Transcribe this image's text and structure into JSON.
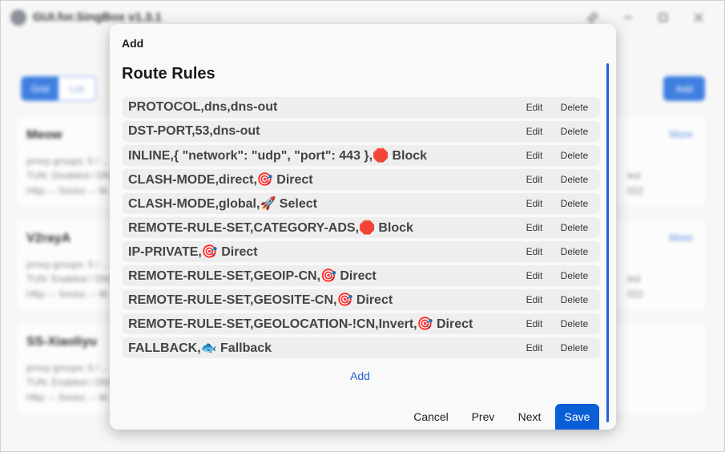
{
  "window": {
    "title": "GUI.for.SingBox v1.3.1",
    "pin_icon": "pin-icon",
    "minimize_icon": "minimize-icon",
    "maximize_icon": "maximize-icon",
    "close_icon": "close-icon"
  },
  "background": {
    "view_toggle": [
      "Grid",
      "List"
    ],
    "add_label": "Add",
    "profiles": [
      {
        "name": "Meow",
        "more": "More",
        "lines": [
          "proxy-groups: 5 / ...",
          "TUN: Disabled / DNS ...",
          "Http: -- Socks: -- M..."
        ],
        "right": [
          "led",
          "022"
        ]
      },
      {
        "name": "V2rayA",
        "more": "More",
        "lines": [
          "proxy-groups: 5 / ...",
          "TUN: Enabled / DNS ...",
          "Http: -- Socks: -- M..."
        ],
        "right": [
          "led",
          "022"
        ]
      },
      {
        "name": "SS-Xiaoliyu",
        "more": "",
        "lines": [
          "proxy-groups: 5 / ...",
          "TUN: Enabled / DNS ...",
          "Http: -- Socks: -- M..."
        ],
        "right": [
          "",
          ""
        ]
      }
    ]
  },
  "modal": {
    "title": "Add",
    "section_title": "Route Rules",
    "edit_label": "Edit",
    "delete_label": "Delete",
    "rules": [
      "PROTOCOL,dns,dns-out",
      "DST-PORT,53,dns-out",
      "INLINE,{ \"network\": \"udp\", \"port\": 443 },🛑 Block",
      "CLASH-MODE,direct,🎯 Direct",
      "CLASH-MODE,global,🚀 Select",
      "REMOTE-RULE-SET,CATEGORY-ADS,🛑 Block",
      "IP-PRIVATE,🎯 Direct",
      "REMOTE-RULE-SET,GEOIP-CN,🎯 Direct",
      "REMOTE-RULE-SET,GEOSITE-CN,🎯 Direct",
      "REMOTE-RULE-SET,GEOLOCATION-!CN,Invert,🎯 Direct",
      "FALLBACK,🐟 Fallback"
    ],
    "add_rule_label": "Add",
    "footer": {
      "cancel": "Cancel",
      "prev": "Prev",
      "next": "Next",
      "save": "Save"
    }
  }
}
